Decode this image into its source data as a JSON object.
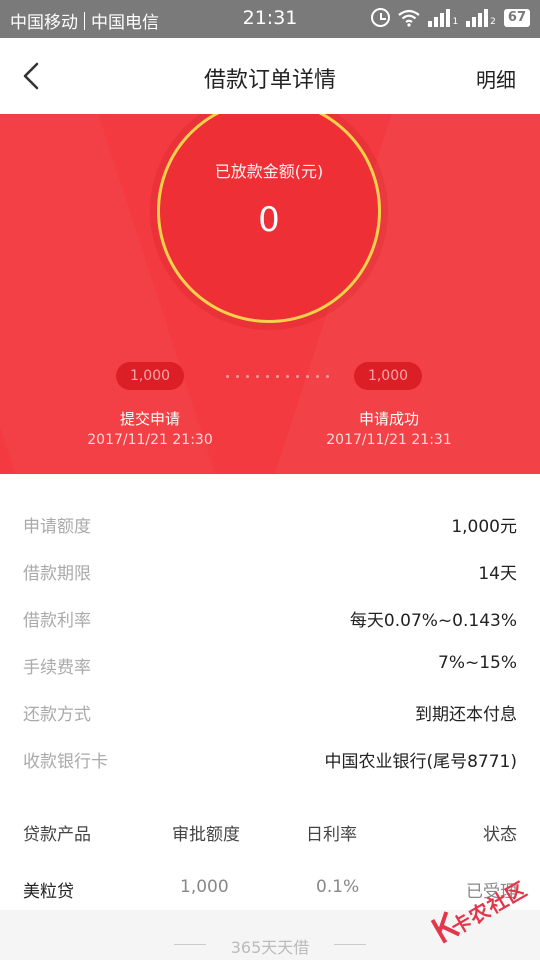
{
  "status_bar": {
    "carrier1": "中国移动",
    "carrier2": "中国电信",
    "time": "21:31",
    "sim1_tag": "1",
    "sim2_tag": "2",
    "battery": "67"
  },
  "header": {
    "title": "借款订单详情",
    "right_link": "明细"
  },
  "hero": {
    "amount_label": "已放款金额(元)",
    "amount_value": "0",
    "steps": [
      {
        "amount": "1,000",
        "label": "提交申请",
        "time": "2017/11/21 21:30"
      },
      {
        "amount": "1,000",
        "label": "申请成功",
        "time": "2017/11/21 21:31"
      }
    ]
  },
  "details": [
    {
      "key": "申请额度",
      "value": "1,000元"
    },
    {
      "key": "借款期限",
      "value": "14天"
    },
    {
      "key": "借款利率",
      "value": "每天0.07%~0.143%"
    },
    {
      "key": "手续费率",
      "value": "7%~15%"
    },
    {
      "key": "还款方式",
      "value": "到期还本付息"
    },
    {
      "key": "收款银行卡",
      "value": "中国农业银行(尾号8771)"
    }
  ],
  "table": {
    "headers": [
      "贷款产品",
      "审批额度",
      "日利率",
      "状态"
    ],
    "rows": [
      [
        "美粒贷",
        "1,000",
        "0.1%",
        "已受理"
      ]
    ]
  },
  "footer": {
    "text": "365天天借"
  },
  "watermark": {
    "text": "卡农社区"
  },
  "colors": {
    "hero_red": "#f23a40",
    "ring_gold": "#f6d24c"
  }
}
